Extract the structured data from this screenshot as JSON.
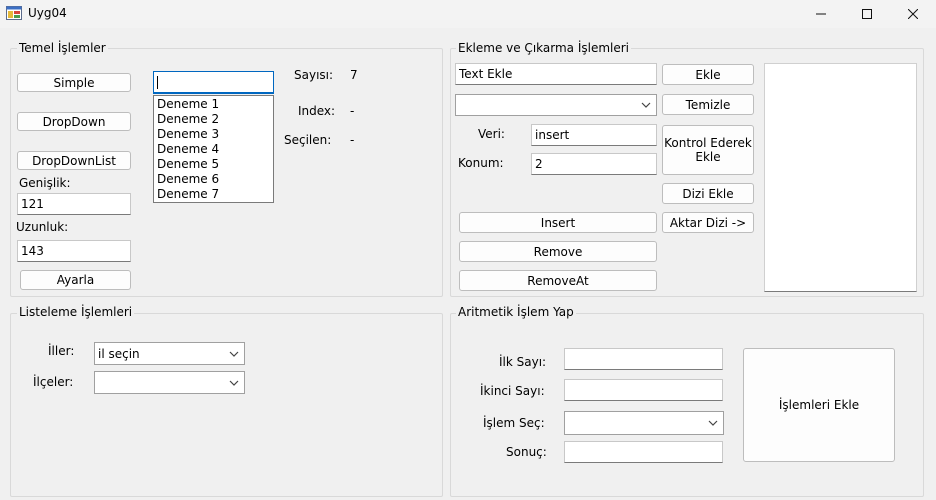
{
  "window": {
    "title": "Uyg04",
    "minimize_icon": "minimize-icon",
    "maximize_icon": "maximize-icon",
    "close_icon": "close-icon"
  },
  "temel": {
    "group_title": "Temel İşlemler",
    "simple_button": "Simple",
    "dropdown_button": "DropDown",
    "dropdownlist_button": "DropDownList",
    "genislik_label": "Genişlik:",
    "genislik_value": "121",
    "uzunluk_label": "Uzunluk:",
    "uzunluk_value": "143",
    "ayarla_button": "Ayarla",
    "combo_text": "",
    "list_items": [
      "Deneme 1",
      "Deneme 2",
      "Deneme 3",
      "Deneme 4",
      "Deneme 5",
      "Deneme 6",
      "Deneme 7"
    ],
    "sayisi_label": "Sayısı:",
    "sayisi_value": "7",
    "index_label": "Index:",
    "index_value": "-",
    "secilen_label": "Seçilen:",
    "secilen_value": "-"
  },
  "ekleme": {
    "group_title": "Ekleme ve Çıkarma İşlemleri",
    "text_ekle_value": "Text Ekle",
    "ekle_button": "Ekle",
    "combo_value": "",
    "temizle_button": "Temizle",
    "veri_label": "Veri:",
    "veri_value": "insert",
    "konum_label": "Konum:",
    "konum_value": "2",
    "kontrol_button": "Kontrol Ederek Ekle",
    "dizi_ekle_button": "Dizi Ekle",
    "aktar_button": "Aktar Dizi ->",
    "insert_button": "Insert",
    "remove_button": "Remove",
    "removeat_button": "RemoveAt"
  },
  "listeleme": {
    "group_title": "Listeleme İşlemleri",
    "iller_label": "İller:",
    "iller_value": "il seçin",
    "ilceler_label": "İlçeler:",
    "ilceler_value": ""
  },
  "aritmetik": {
    "group_title": "Aritmetik İşlem Yap",
    "ilk_label": "İlk Sayı:",
    "ikinci_label": "İkinci Sayı:",
    "islem_label": "İşlem Seç:",
    "sonuc_label": "Sonuç:",
    "ilk_value": "",
    "ikinci_value": "",
    "islem_value": "",
    "sonuc_value": "",
    "islemleri_ekle_button": "İşlemleri Ekle"
  }
}
